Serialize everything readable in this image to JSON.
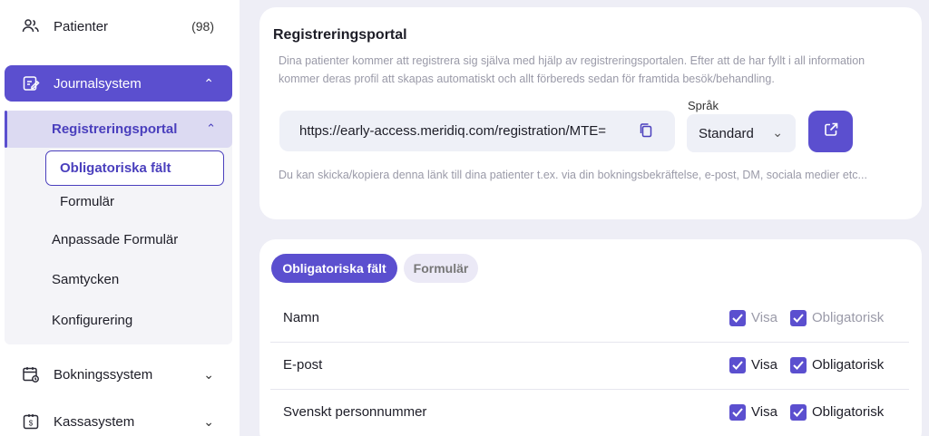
{
  "sidebar": {
    "patients": {
      "label": "Patienter",
      "count": "(98)"
    },
    "journal": {
      "label": "Journalsystem"
    },
    "registration": {
      "label": "Registreringsportal"
    },
    "sub_items": [
      "Obligatoriska fält",
      "Formulär"
    ],
    "items": [
      "Anpassade Formulär",
      "Samtycken",
      "Konfigurering"
    ],
    "booking": {
      "label": "Bokningssystem"
    },
    "cash": {
      "label": "Kassasystem"
    }
  },
  "portal": {
    "title": "Registreringsportal",
    "description": "Dina patienter kommer att registrera sig själva med hjälp av registreringsportalen. Efter att de har fyllt i all information kommer deras profil att skapas automatiskt och allt förbereds sedan för framtida besök/behandling.",
    "url": "https://early-access.meridiq.com/registration/MTE=",
    "language_label": "Språk",
    "language_value": "Standard",
    "hint": "Du kan skicka/kopiera denna länk till dina patienter t.ex. via din bokningsbekräftelse, e-post, DM, sociala medier etc..."
  },
  "fields": {
    "tabs": [
      "Obligatoriska fält",
      "Formulär"
    ],
    "show_label": "Visa",
    "required_label": "Obligatorisk",
    "rows": [
      {
        "name": "Namn",
        "show": true,
        "required": true,
        "locked": true
      },
      {
        "name": "E-post",
        "show": true,
        "required": true,
        "locked": false
      },
      {
        "name": "Svenskt personnummer",
        "show": true,
        "required": true,
        "locked": false
      }
    ]
  },
  "colors": {
    "accent": "#5b4fcf",
    "background": "#eeeef6"
  }
}
